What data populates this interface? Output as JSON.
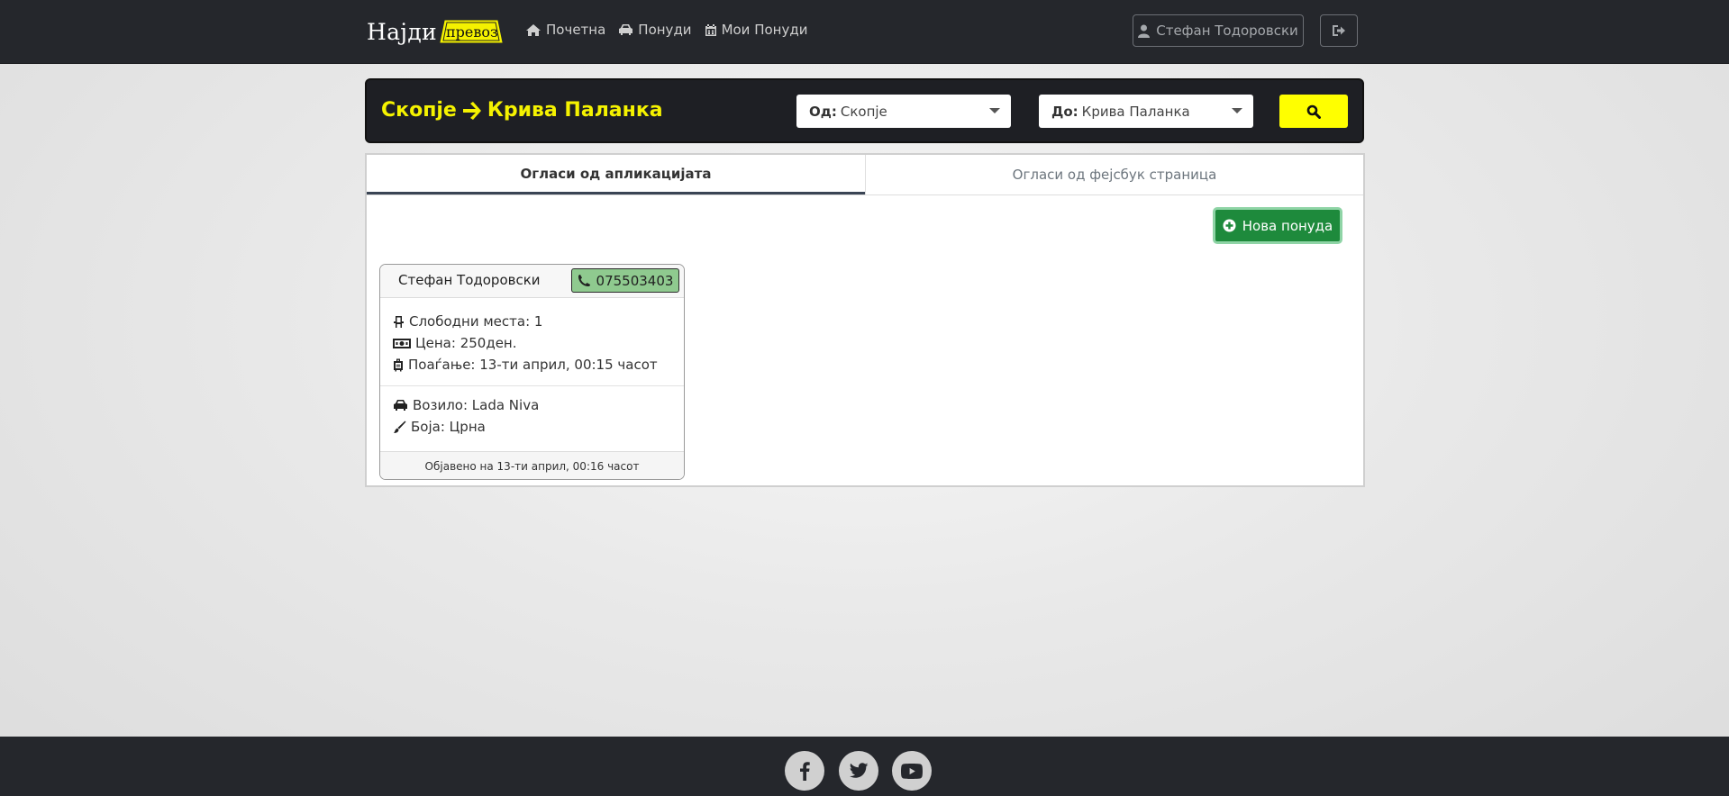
{
  "nav": {
    "brand_main": "Најди",
    "brand_plate": "превоз",
    "links": [
      {
        "label": "Почетна",
        "icon": "home-icon"
      },
      {
        "label": "Понуди",
        "icon": "car-icon"
      },
      {
        "label": "Мои Понуди",
        "icon": "calendar-icon"
      }
    ],
    "user": "Стефан Тодоровски"
  },
  "search": {
    "route_from": "Скопје",
    "route_to": "Крива Паланка",
    "from_label": "Од:",
    "from_value": "Скопје",
    "to_label": "До:",
    "to_value": "Крива Паланка"
  },
  "tabs": {
    "app": "Огласи од апликацијата",
    "facebook": "Огласи од фејсбук страница"
  },
  "new_offer_label": "Нова понуда",
  "offer": {
    "driver": "Стефан Тодоровски",
    "phone": "075503403",
    "seats": "Слободни места: 1",
    "price": "Цена: 250ден.",
    "departure": "Поаѓање: 13-ти април, 00:15 часот",
    "vehicle": "Возило: Lada Niva",
    "color": "Боја: Црна",
    "posted": "Објавено на 13-ти април, 00:16 часот"
  },
  "colors": {
    "navbar": "#25272c",
    "accent_yellow": "#f5f200",
    "success_green": "#1e8a3c",
    "phone_badge": "#8fca8f"
  }
}
